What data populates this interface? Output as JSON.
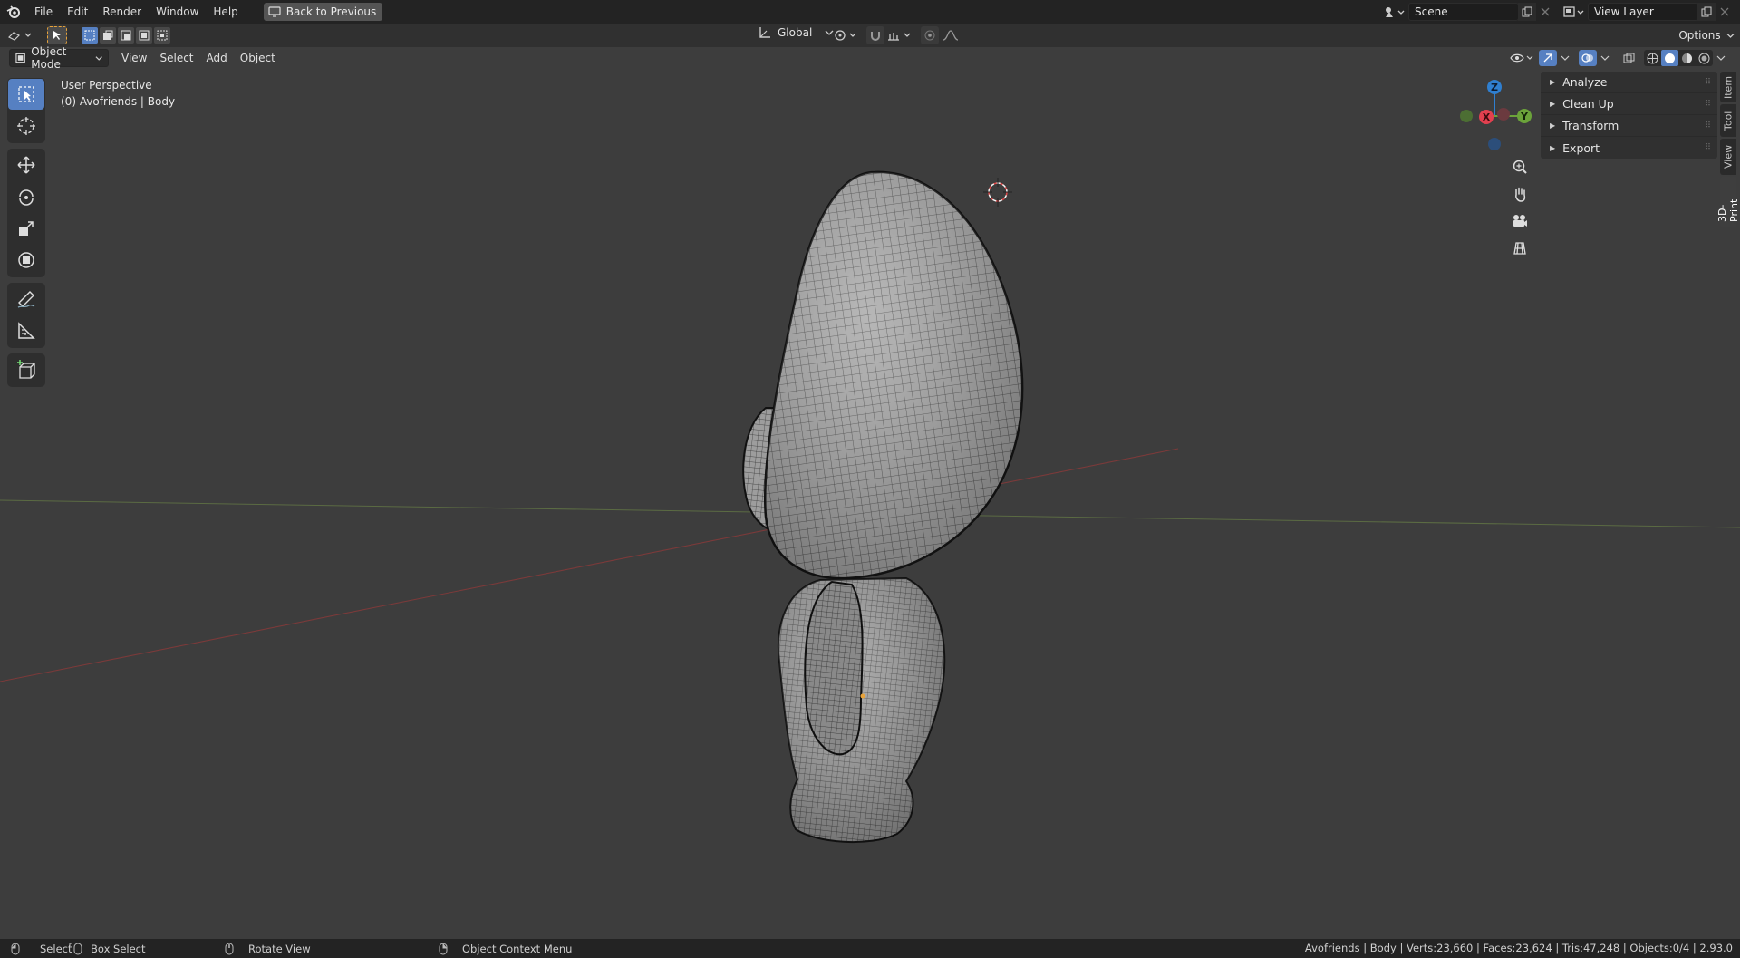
{
  "topbar": {
    "menus": [
      "File",
      "Edit",
      "Render",
      "Window",
      "Help"
    ],
    "back_button": "Back to Previous",
    "scene": "Scene",
    "view_layer": "View Layer"
  },
  "tool_header": {
    "transform_orientation": "Global",
    "options_label": "Options"
  },
  "viewport_header": {
    "mode": "Object Mode",
    "menus": [
      "View",
      "Select",
      "Add",
      "Object"
    ]
  },
  "viewport": {
    "perspective_label": "User Perspective",
    "object_label": "(0) Avofriends | Body",
    "gizmo": {
      "z": "Z",
      "y": "Y",
      "x": "X"
    }
  },
  "npanel": {
    "sections": [
      "Analyze",
      "Clean Up",
      "Transform",
      "Export"
    ],
    "tabs": [
      "Item",
      "Tool",
      "View",
      "3D-Print"
    ],
    "active_tab": "3D-Print"
  },
  "statusbar": {
    "select": "Select",
    "box_select": "Box Select",
    "rotate_view": "Rotate View",
    "context_menu": "Object Context Menu",
    "stats": "Avofriends | Body | Verts:23,660 | Faces:23,624 | Tris:47,248 | Objects:0/4 | 2.93.0"
  },
  "colors": {
    "accent": "#5680c2",
    "axis_x": "#e2404f",
    "axis_y": "#6ba33a",
    "axis_z": "#2f7fd0",
    "background": "#3d3d3d"
  }
}
